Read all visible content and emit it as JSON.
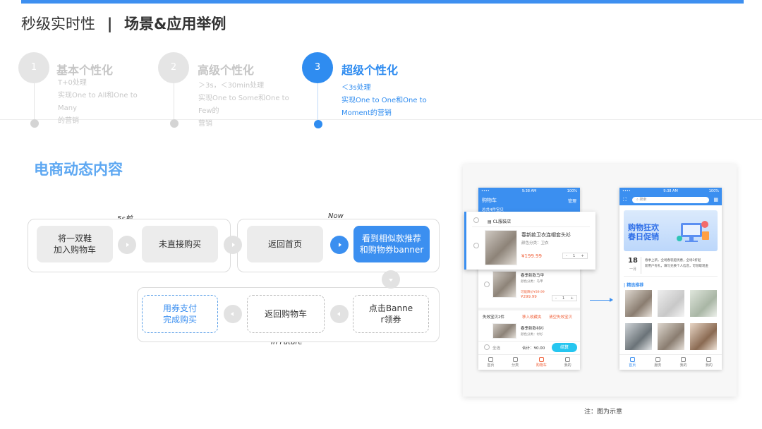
{
  "title": {
    "prefix": "秒级实时性",
    "separator": "|",
    "main": "场景&应用举例"
  },
  "steps": [
    {
      "number": "1",
      "title": "基本个性化",
      "lines": [
        "T+0处理",
        "实现One to All和One to Many",
        "的营销"
      ]
    },
    {
      "number": "2",
      "title": "高级个性化",
      "lines": [
        "＞3s，＜30min处理",
        "实现One to Some和One to Few的",
        "营销"
      ]
    },
    {
      "number": "3",
      "title": "超级个性化",
      "lines": [
        "＜3s处理",
        "实现One to One和One to",
        "Moment的营销"
      ]
    }
  ],
  "section_title": "电商动态内容",
  "flow": {
    "label_past": "5s前",
    "label_now": "Now",
    "label_future": "In Future",
    "add_to_cart": "将一双鞋\n加入购物车",
    "not_bought": "未直接购买",
    "back_home": "返回首页",
    "see_recommend": "看到相似款推荐\n和购物券banner",
    "click_banner": "点击Banne\nr领券",
    "back_cart": "返回购物车",
    "pay_coupon": "用券支付\n完成购买"
  },
  "mock_cart": {
    "time": "9:38 AM",
    "signal": "••••",
    "battery": "100%",
    "header": "购物车",
    "manage": "管理",
    "sub": "总共4件宝贝",
    "shop": "CL服装店",
    "item1_name": "春新款卫衣连帽套头衫",
    "item1_spec": "颜色分类：卫衣",
    "item1_price": "¥199.99",
    "item2_name": "春季新款马甲",
    "item2_spec": "颜色分类：马甲",
    "item2_old": "可能降价¥39.99",
    "item2_price": "¥299.99",
    "qty": "1",
    "invalid": "失效宝贝2件",
    "move_fav": "移入收藏夹",
    "clear_invalid": "清空失效宝贝",
    "item3_name": "春季新款衬衫",
    "item3_spec": "颜色分类：衬衫",
    "select_all": "全选",
    "total": "合计：¥0.00",
    "checkout": "结算",
    "tabs": [
      "首页",
      "分类",
      "购物车",
      "我的"
    ]
  },
  "mock_home": {
    "time": "9:38 AM",
    "signal": "••••",
    "battery": "100%",
    "search_placeholder": "搜索",
    "banner_line1": "购物狂欢",
    "banner_line2": "春日促销",
    "date_day": "18",
    "date_month": "一月",
    "notice1": "春季上新，全场春装超优惠，全场3折起",
    "notice2": "新用户有礼，填写兑换个人信息，可领取现金",
    "recommend_title": "| 精选推荐",
    "tabs": [
      "首页",
      "服务",
      "我的",
      "我的"
    ]
  },
  "note": "注：图为示意",
  "colors": {
    "accent": "#3b8ff0",
    "inactive": "#e5e5e5",
    "section": "#5ea8f2"
  }
}
